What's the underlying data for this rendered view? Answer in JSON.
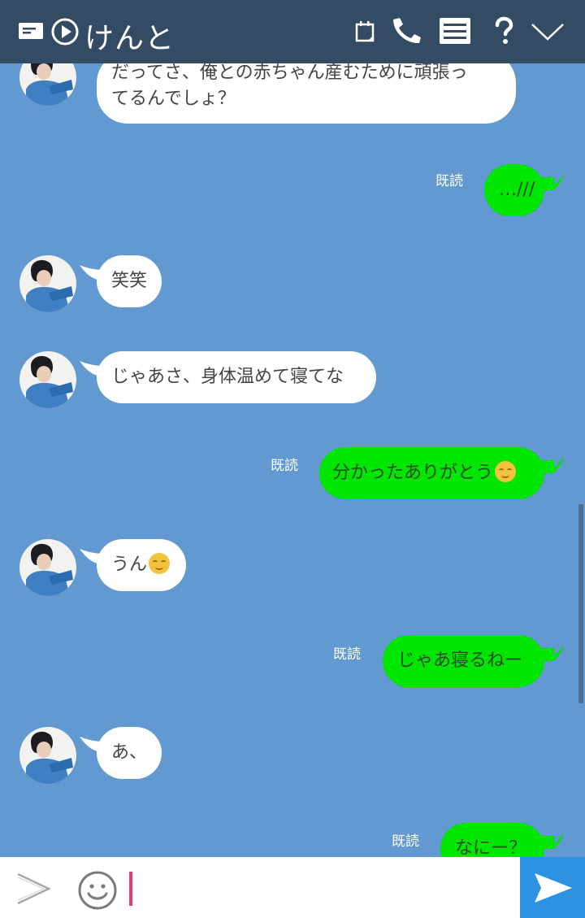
{
  "header": {
    "title": "けんと",
    "icons": [
      "keep-note-icon",
      "play-icon",
      "calendar-icon",
      "phone-icon",
      "menu-icon",
      "help-icon",
      "chevron-down-icon"
    ]
  },
  "messages": [
    {
      "side": "in",
      "lines": [
        "だってさ、俺との赤ちゃん産むために頑張っ",
        "てるんでしょ？"
      ]
    },
    {
      "side": "out",
      "text": "…///",
      "read": "既読"
    },
    {
      "side": "in",
      "text": "笑笑"
    },
    {
      "side": "in",
      "text": "じゃあさ、身体温めて寝てな"
    },
    {
      "side": "out",
      "text": "分かったありがとう",
      "emoji": "smile",
      "read": "既読"
    },
    {
      "side": "in",
      "text": "うん",
      "emoji": "smile"
    },
    {
      "side": "out",
      "text": "じゃあ寝るねー",
      "read": "既読"
    },
    {
      "side": "in",
      "text": "あ、"
    },
    {
      "side": "out",
      "text": "なにー？",
      "read": "既読"
    }
  ],
  "input": {
    "placeholder": "",
    "icons": [
      "expand-chevron-icon",
      "emoji-icon",
      "send-icon"
    ]
  },
  "colors": {
    "header_bg": "#344c63",
    "chat_bg": "#6199d0",
    "outgoing_bubble": "#00e600",
    "incoming_bubble": "#ffffff",
    "send_button": "#2e92e0",
    "cursor": "#e23c78"
  }
}
